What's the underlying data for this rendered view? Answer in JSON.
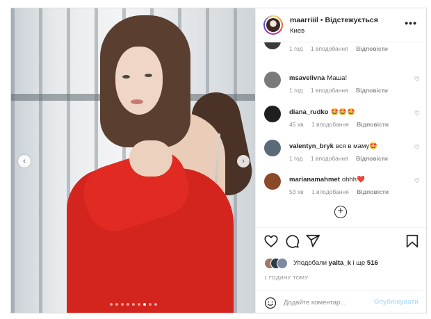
{
  "header": {
    "username": "maarriiil",
    "separator": "•",
    "follow_label": "Відстежується",
    "location": "Киев",
    "more_label": "•••"
  },
  "top_comment_meta": {
    "time": "1 год",
    "likes": "1 вподобання",
    "reply": "Відповісти"
  },
  "comments": [
    {
      "user": "msavelivna",
      "text": "Маша!",
      "time": "1 год",
      "likes": "1 вподобання",
      "reply": "Відповісти",
      "avatar_color": "#7a7a7a"
    },
    {
      "user": "diana_rudko",
      "text": "🤩🤩🤩",
      "time": "45 хв",
      "likes": "1 вподобання",
      "reply": "Відповісти",
      "avatar_color": "#1f1f1f"
    },
    {
      "user": "valentyn_bryk",
      "text": "вся в маму🤩",
      "time": "1 год",
      "likes": "1 вподобання",
      "reply": "Відповісти",
      "avatar_color": "#5b6a78"
    },
    {
      "user": "marianamahmet",
      "text": "ohhh❤️",
      "time": "53 хв",
      "likes": "1 вподобання",
      "reply": "Відповісти",
      "avatar_color": "#8a4a2a"
    }
  ],
  "heart_glyph": "♡",
  "add_more_glyph": "+",
  "likes": {
    "prefix": "Уподобали",
    "user": "yalta_k",
    "middle": "і ще",
    "count": "516"
  },
  "timestamp": "1 ГОДИНУ ТОМУ",
  "comment_input": {
    "placeholder": "Додайте коментар...",
    "post_label": "Опублікувати"
  },
  "carousel": {
    "total": 9,
    "active_index": 6
  },
  "nav": {
    "prev_glyph": "‹",
    "next_glyph": "›"
  },
  "colors": {
    "link": "#b2dffc",
    "muted": "#8e8e8e",
    "text": "#262626",
    "shirt": "#d4241e"
  }
}
